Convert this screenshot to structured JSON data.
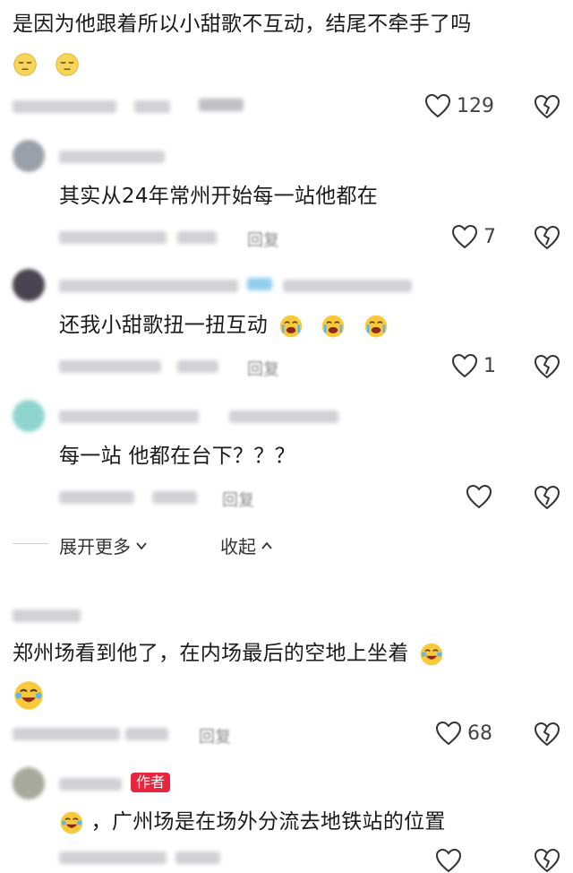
{
  "comment1": {
    "text": "是因为他跟着所以小甜歌不互动，结尾不牵手了吗",
    "likes": "129"
  },
  "reply1": {
    "text": "其实从24年常州开始每一站他都在",
    "likes": "7",
    "reply_label": "回复"
  },
  "reply2": {
    "text": "还我小甜歌扭一扭互动",
    "likes": "1",
    "reply_label": "回复"
  },
  "reply3": {
    "text": "每一站  他都在台下？？？",
    "likes": "",
    "reply_label": "回复"
  },
  "thread": {
    "expand_label": "展开更多",
    "collapse_label": "收起"
  },
  "comment2": {
    "text_line1": "郑州场看到他了，在内场最后的空地上坐着",
    "likes": "68",
    "reply_label": "回复"
  },
  "reply4": {
    "badge": "作者",
    "text": "，广州场是在场外分流去地铁站的位置"
  },
  "icons": {
    "like": "heart-outline-icon",
    "dislike": "broken-heart-icon",
    "emoji_sleepy": "sleepy-face-emoji",
    "emoji_cry": "crying-face-emoji",
    "emoji_laughcry": "laugh-cry-emoji"
  },
  "colors": {
    "text": "#1a1a1a",
    "meta": "#9a9a9a",
    "author_badge": "#e8253e"
  }
}
